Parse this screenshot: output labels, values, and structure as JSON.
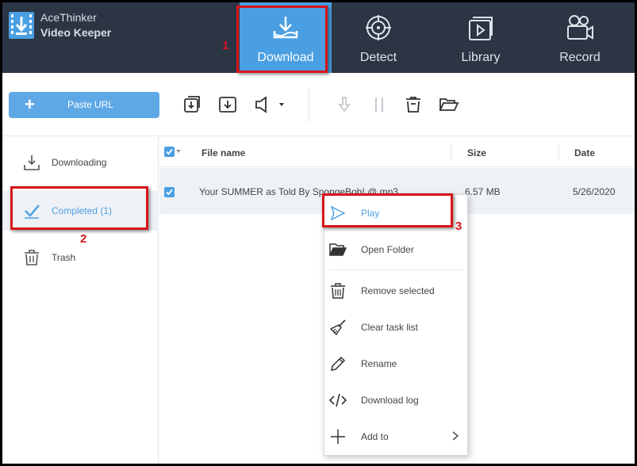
{
  "app": {
    "name_line1": "AceThinker",
    "name_line2": "Video Keeper"
  },
  "nav": {
    "tabs": [
      {
        "label": "Download",
        "icon": "download-tray-icon",
        "active": true
      },
      {
        "label": "Detect",
        "icon": "crosshair-icon",
        "active": false
      },
      {
        "label": "Library",
        "icon": "library-play-icon",
        "active": false
      },
      {
        "label": "Record",
        "icon": "video-camera-icon",
        "active": false
      }
    ]
  },
  "toolbar": {
    "paste_url_label": "Paste URL",
    "buttons": [
      "import-icon",
      "download-box-icon",
      "speaker-icon",
      "resume-icon",
      "pause-icon",
      "delete-icon",
      "open-folder-icon"
    ]
  },
  "sidebar": {
    "items": [
      {
        "label": "Downloading",
        "icon": "download-icon",
        "active": false
      },
      {
        "label": "Completed (1)",
        "icon": "check-icon",
        "active": true
      },
      {
        "label": "Trash",
        "icon": "trash-icon",
        "active": false
      }
    ]
  },
  "table": {
    "columns": [
      "File name",
      "Size",
      "Date"
    ],
    "rows": [
      {
        "file_name": "Your SUMMER as Told By SpongeBob! @.mp3",
        "size": "6.57 MB",
        "date": "5/26/2020",
        "checked": true
      }
    ]
  },
  "context_menu": {
    "items": [
      {
        "label": "Play",
        "icon": "play-icon",
        "highlighted": true
      },
      {
        "label": "Open Folder",
        "icon": "folder-icon"
      },
      {
        "label": "Remove selected",
        "icon": "trash-icon"
      },
      {
        "label": "Clear task list",
        "icon": "broom-icon"
      },
      {
        "label": "Rename",
        "icon": "pencil-icon"
      },
      {
        "label": "Download log",
        "icon": "code-icon"
      },
      {
        "label": "Add to",
        "icon": "plus-icon",
        "submenu": true
      }
    ]
  },
  "annotations": {
    "step1": "1",
    "step2": "2",
    "step3": "3"
  },
  "colors": {
    "accent": "#4a9fe3",
    "topbar": "#2c3544",
    "highlight_box": "#d8141b"
  }
}
